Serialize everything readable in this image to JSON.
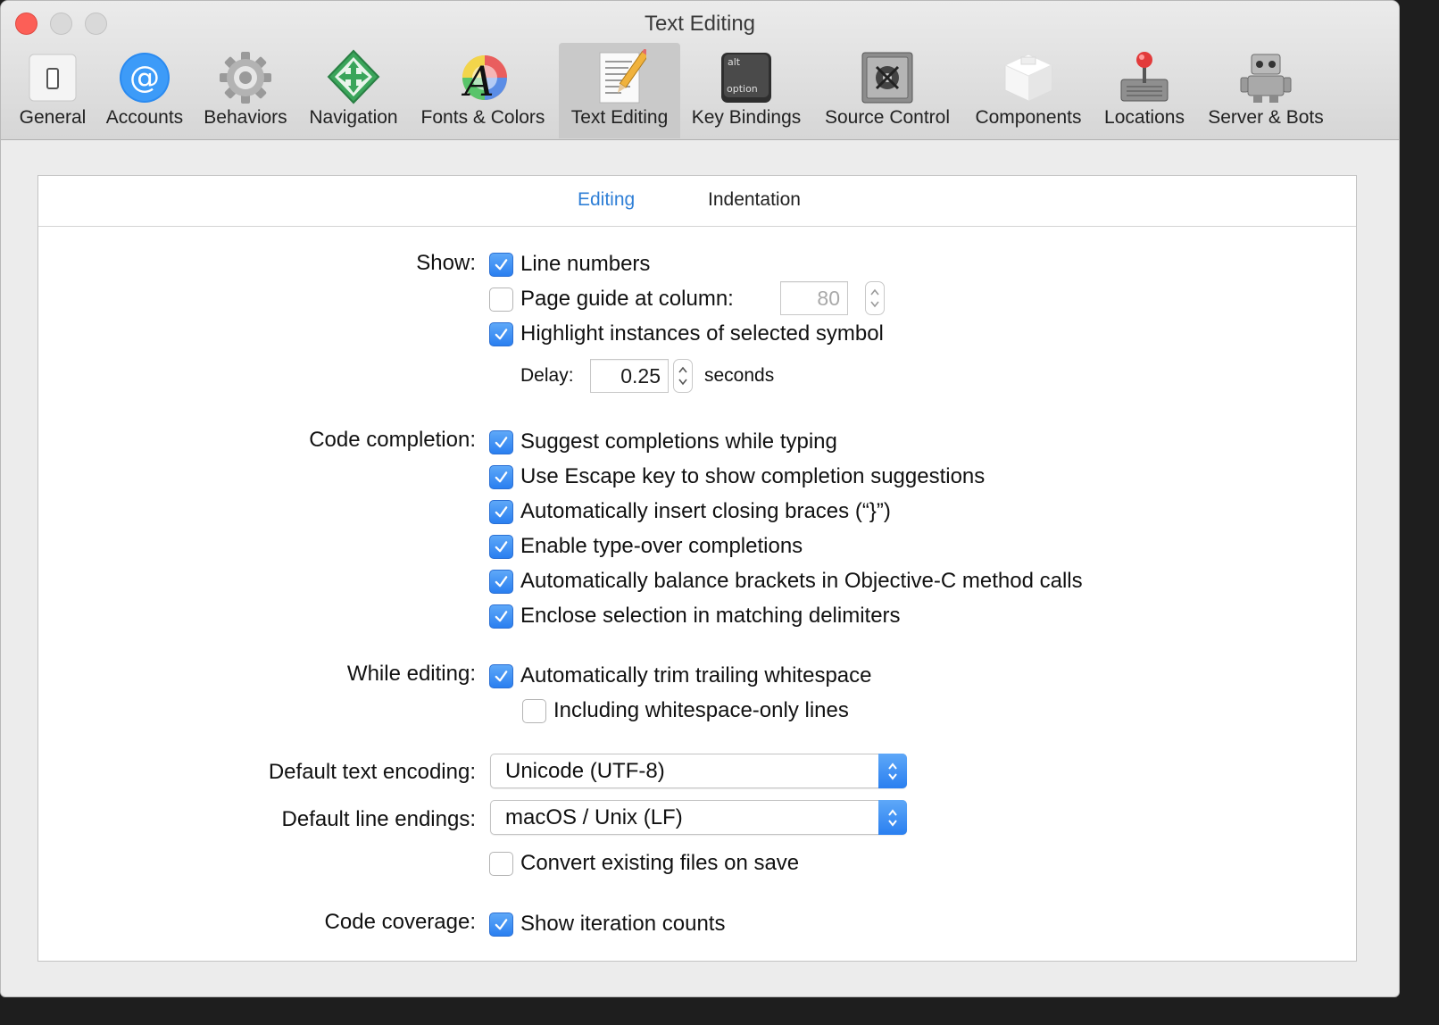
{
  "window": {
    "title": "Text Editing"
  },
  "toolbar": {
    "items": [
      {
        "label": "General",
        "icon": "general-switch-icon"
      },
      {
        "label": "Accounts",
        "icon": "at-sign-icon"
      },
      {
        "label": "Behaviors",
        "icon": "gear-icon"
      },
      {
        "label": "Navigation",
        "icon": "navigation-arrows-icon"
      },
      {
        "label": "Fonts & Colors",
        "icon": "font-color-wheel-icon"
      },
      {
        "label": "Text Editing",
        "icon": "document-pencil-icon",
        "selected": true
      },
      {
        "label": "Key Bindings",
        "icon": "alt-option-key-icon",
        "key_top": "alt",
        "key_bottom": "option"
      },
      {
        "label": "Source Control",
        "icon": "vault-safe-icon"
      },
      {
        "label": "Components",
        "icon": "component-box-icon"
      },
      {
        "label": "Locations",
        "icon": "joystick-drive-icon"
      },
      {
        "label": "Server & Bots",
        "icon": "robot-icon"
      }
    ]
  },
  "tabs": [
    {
      "label": "Editing",
      "active": true
    },
    {
      "label": "Indentation",
      "active": false
    }
  ],
  "show": {
    "label": "Show:",
    "line_numbers": {
      "label": "Line numbers",
      "checked": true
    },
    "page_guide": {
      "label": "Page guide at column:",
      "checked": false,
      "value": "80"
    },
    "highlight": {
      "label": "Highlight instances of selected symbol",
      "checked": true
    },
    "delay": {
      "label": "Delay:",
      "value": "0.25",
      "unit": "seconds"
    }
  },
  "code_completion": {
    "label": "Code completion:",
    "options": [
      {
        "label": "Suggest completions while typing",
        "checked": true
      },
      {
        "label": "Use Escape key to show completion suggestions",
        "checked": true
      },
      {
        "label": "Automatically insert closing braces (“}”)",
        "checked": true
      },
      {
        "label": "Enable type-over completions",
        "checked": true
      },
      {
        "label": "Automatically balance brackets in Objective-C method calls",
        "checked": true
      },
      {
        "label": "Enclose selection in matching delimiters",
        "checked": true
      }
    ]
  },
  "while_editing": {
    "label": "While editing:",
    "trim": {
      "label": "Automatically trim trailing whitespace",
      "checked": true
    },
    "whitespace_only": {
      "label": "Including whitespace-only lines",
      "checked": false
    }
  },
  "encoding": {
    "label": "Default text encoding:",
    "value": "Unicode (UTF-8)"
  },
  "line_endings": {
    "label": "Default line endings:",
    "value": "macOS / Unix (LF)"
  },
  "convert": {
    "label": "Convert existing files on save",
    "checked": false
  },
  "coverage": {
    "label": "Code coverage:",
    "iteration_counts": {
      "label": "Show iteration counts",
      "checked": true
    }
  },
  "colors": {
    "accent": "#2f7fd6",
    "checkbox_blue": "#2a7ff0",
    "close_red": "#fc5f57"
  }
}
